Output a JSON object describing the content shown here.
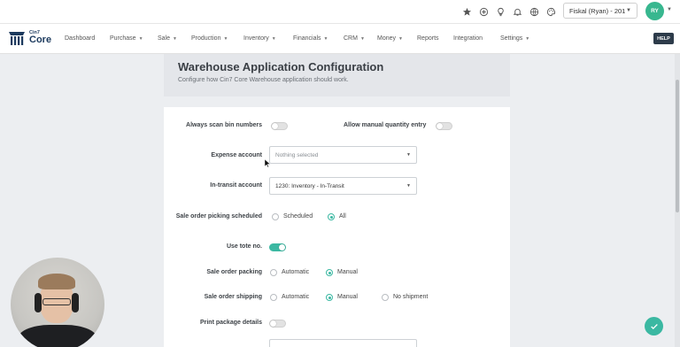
{
  "topbar": {
    "icons": [
      "star-icon",
      "plus-circle-icon",
      "lightbulb-icon",
      "bell-icon",
      "globe-icon",
      "palette-icon"
    ],
    "company_selector": "Fiskal (Ryan) - 201",
    "avatar_initials": "RY"
  },
  "brand": {
    "small": "Cin7",
    "big": "Core"
  },
  "nav": {
    "items": [
      {
        "label": "Dashboard",
        "dropdown": false
      },
      {
        "label": "Purchase",
        "dropdown": true
      },
      {
        "label": "Sale",
        "dropdown": true
      },
      {
        "label": "Production",
        "dropdown": true
      },
      {
        "label": "Inventory",
        "dropdown": true
      },
      {
        "label": "Financials",
        "dropdown": true
      },
      {
        "label": "CRM",
        "dropdown": true
      },
      {
        "label": "Money",
        "dropdown": true
      },
      {
        "label": "Reports",
        "dropdown": false
      },
      {
        "label": "Integration",
        "dropdown": false
      },
      {
        "label": "Settings",
        "dropdown": true
      }
    ],
    "help_label": "HELP"
  },
  "page": {
    "title": "Warehouse Application Configuration",
    "subtitle": "Configure how Cin7 Core Warehouse application should work."
  },
  "form": {
    "always_scan_bin_numbers": {
      "label": "Always scan bin numbers",
      "on": false
    },
    "allow_manual_quantity_entry": {
      "label": "Allow manual quantity entry",
      "on": false
    },
    "expense_account": {
      "label": "Expense account",
      "value": "Nothing selected"
    },
    "in_transit_account": {
      "label": "In-transit account",
      "value": "1230: Inventory - In-Transit"
    },
    "sale_order_picking_scheduled": {
      "label": "Sale order picking scheduled",
      "options": [
        "Scheduled",
        "All"
      ],
      "selected": "All"
    },
    "use_tote_no": {
      "label": "Use tote no.",
      "on": true
    },
    "sale_order_packing": {
      "label": "Sale order packing",
      "options": [
        "Automatic",
        "Manual"
      ],
      "selected": "Manual"
    },
    "sale_order_shipping": {
      "label": "Sale order shipping",
      "options": [
        "Automatic",
        "Manual",
        "No shipment"
      ],
      "selected": "Manual"
    },
    "print_package_details": {
      "label": "Print package details",
      "on": false
    }
  },
  "colors": {
    "accent": "#3bb8a2",
    "avatar": "#38b78f",
    "help_bg": "#2d3b4a",
    "page_bg": "#eceef1"
  }
}
